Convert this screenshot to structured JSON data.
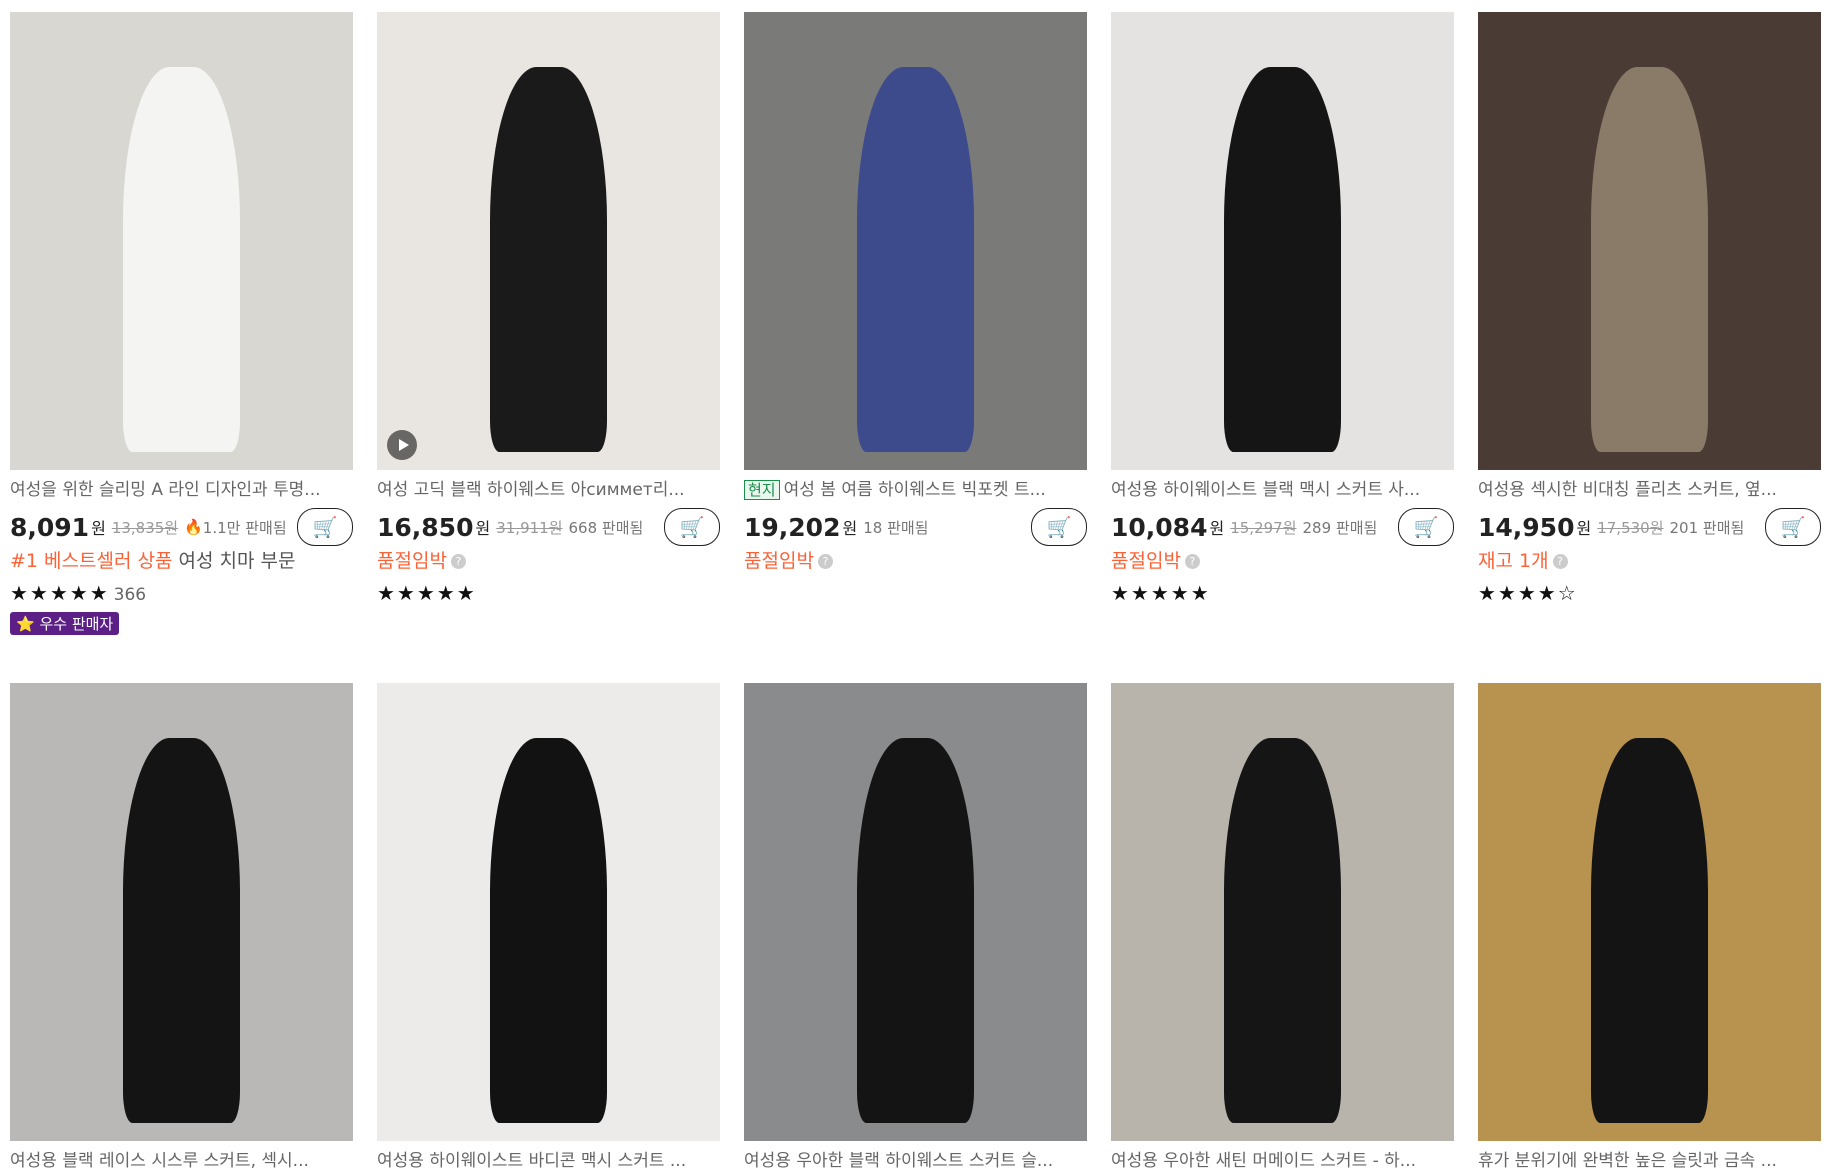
{
  "products": [
    {
      "title": "여성을 위한 슬리밍 A 라인 디자인과 투명...",
      "price": "8,091",
      "currency": "원",
      "original_price": "13,835원",
      "sold": "1.1만 판매됨",
      "sold_fire": true,
      "badge_highlight": "#1 베스트셀러 상품",
      "badge_rest": "여성 치마 부문",
      "stars": "★★★★★",
      "review_count": "366",
      "seller_badge": "⭐ 우수 판매자",
      "image": {
        "bg": "#d9d7d2",
        "figure": "#f4f4f2"
      }
    },
    {
      "title": "여성 고딕 블랙 하이웨스트 아симмет리...",
      "price": "16,850",
      "currency": "원",
      "original_price": "31,911원",
      "sold": "668 판매됨",
      "badge_highlight": "품절임박",
      "stars": "★★★★★",
      "has_video": true,
      "image": {
        "bg": "#e9e6e1",
        "figure": "#1a1a1a"
      }
    },
    {
      "tag": "현지",
      "title": "여성 봄 여름 하이웨스트 빅포켓 트...",
      "price": "19,202",
      "currency": "원",
      "sold": "18 판매됨",
      "badge_highlight": "품절임박",
      "image": {
        "bg": "#7a7a78",
        "figure": "#3d4a8c"
      }
    },
    {
      "title": "여성용 하이웨이스트 블랙 맥시 스커트 사...",
      "price": "10,084",
      "currency": "원",
      "original_price": "15,297원",
      "sold": "289 판매됨",
      "badge_highlight": "품절임박",
      "stars": "★★★★★",
      "image": {
        "bg": "#e4e3e1",
        "figure": "#151515"
      }
    },
    {
      "title": "여성용 섹시한 비대칭 플리츠 스커트, 옆...",
      "price": "14,950",
      "currency": "원",
      "original_price": "17,530원",
      "sold": "201 판매됨",
      "badge_highlight": "재고 1개",
      "stars": "★★★★☆",
      "image": {
        "bg": "#4a3b35",
        "figure": "#8a7a68"
      }
    },
    {
      "title": "여성용 블랙 레이스 시스루 스커트, 섹시...",
      "image": {
        "bg": "#b9b8b6",
        "figure": "#141414"
      }
    },
    {
      "title": "여성용 하이웨이스트 바디콘 맥시 스커트 ...",
      "image": {
        "bg": "#ecebea",
        "figure": "#121212"
      }
    },
    {
      "title": "여성용 우아한 블랙 하이웨스트 스커트 슬...",
      "image": {
        "bg": "#8a8b8d",
        "figure": "#141414"
      }
    },
    {
      "title": "여성용 우아한 새틴 머메이드 스커트 - 하...",
      "image": {
        "bg": "#b8b4ac",
        "figure": "#151515"
      }
    },
    {
      "title": "휴가 분위기에 완벽한 높은 슬릿과 금속 ...",
      "image": {
        "bg": "#b7934f",
        "figure": "#141414"
      }
    }
  ]
}
